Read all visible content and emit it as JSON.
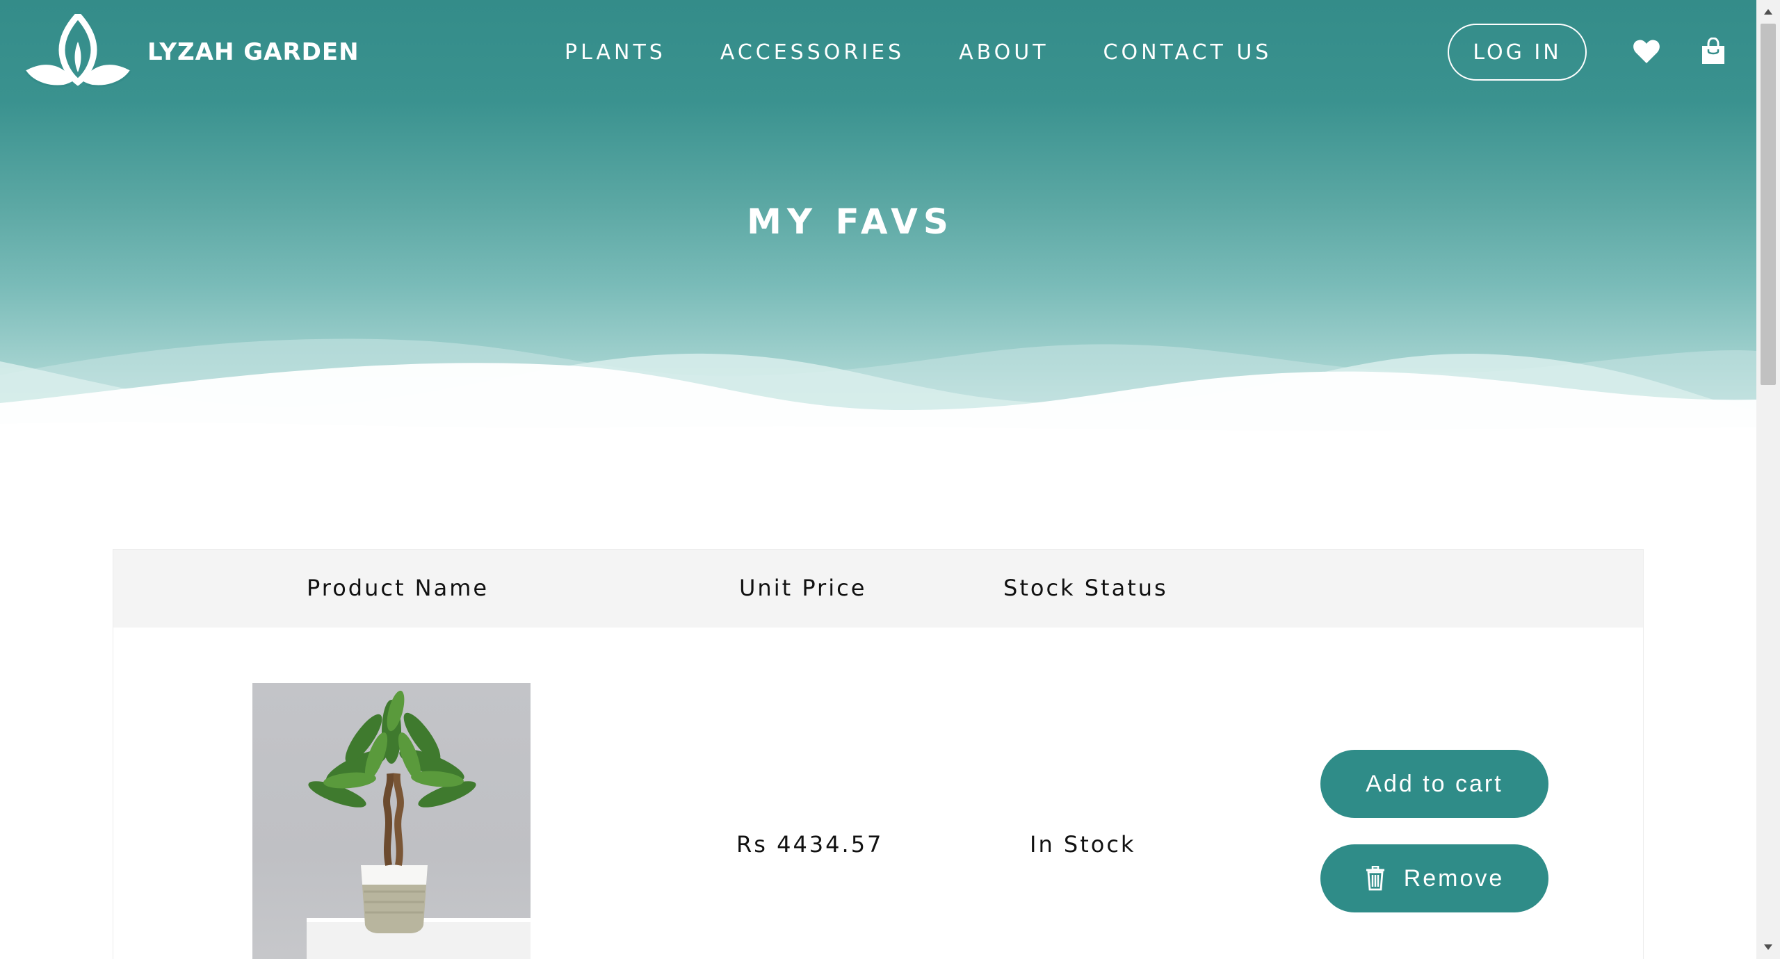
{
  "brand": {
    "name": "LYZAH GARDEN",
    "logo_icon": "lotus-icon"
  },
  "nav": {
    "items": [
      {
        "label": "PLANTS"
      },
      {
        "label": "ACCESSORIES"
      },
      {
        "label": "ABOUT"
      },
      {
        "label": "CONTACT US"
      }
    ],
    "login_label": "LOG IN",
    "heart_icon": "heart-icon",
    "bag_icon": "shopping-bag-icon"
  },
  "hero": {
    "title": "MY FAVS"
  },
  "table": {
    "headers": {
      "name": "Product Name",
      "price": "Unit Price",
      "stock": "Stock Status"
    },
    "rows": [
      {
        "image_icon": "money-tree-plant-image",
        "price": "Rs 4434.57",
        "stock": "In Stock",
        "add_to_cart_label": "Add to cart",
        "remove_label": "Remove",
        "remove_icon": "trash-icon"
      }
    ]
  },
  "colors": {
    "accent": "#2f8c88",
    "hero_top": "#348c89",
    "header_bg": "#f4f4f4"
  }
}
